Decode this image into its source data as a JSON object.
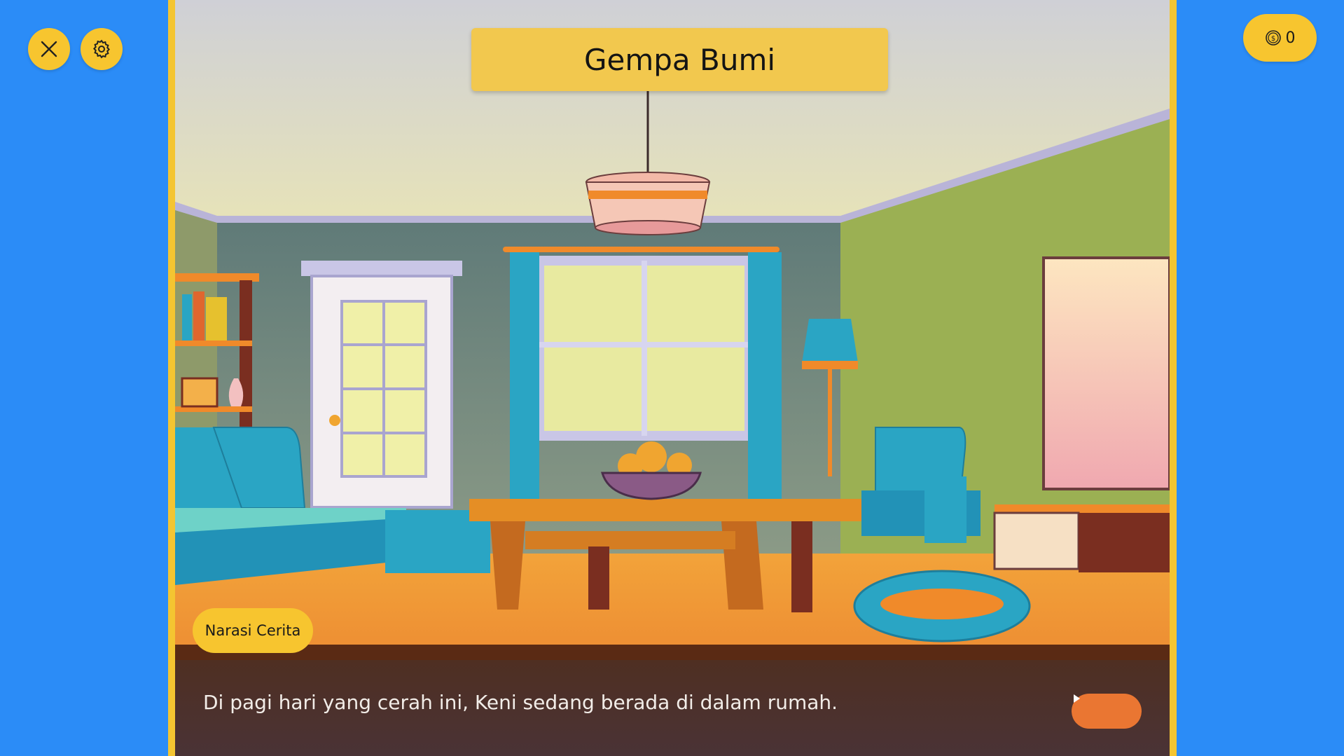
{
  "top_bar": {
    "coins": "0"
  },
  "story": {
    "title": "Gempa Bumi",
    "narration_label": "Narasi Cerita",
    "text": "Di pagi hari yang cerah ini, Keni sedang berada di dalam rumah."
  },
  "icons": {
    "close": "close-icon",
    "settings": "gear-icon",
    "coin": "coin-icon",
    "next": "play-icon"
  },
  "colors": {
    "background": "#2b8cf7",
    "accent_yellow": "#f7c52f",
    "next_button": "#ea7632"
  }
}
